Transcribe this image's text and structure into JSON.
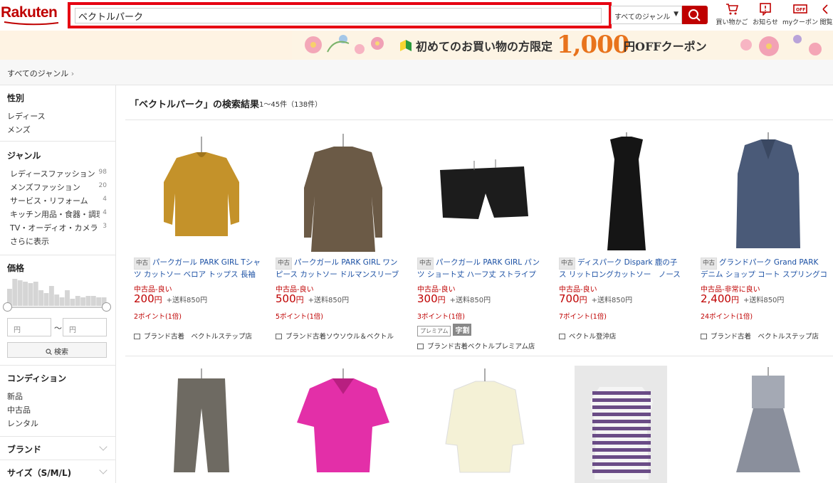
{
  "header": {
    "logo": "Rakuten",
    "search_value": "ベクトルパーク",
    "genre_select": "すべてのジャンル",
    "icons": [
      {
        "label": "買い物かご",
        "icon": "cart-icon"
      },
      {
        "label": "お知らせ",
        "icon": "notice-icon"
      },
      {
        "label": "myクーポン",
        "icon": "coupon-icon"
      },
      {
        "label": "閲覧",
        "icon": "history-icon"
      }
    ]
  },
  "banner": {
    "text": "初めてのお買い物の方限定",
    "amount": "1,000",
    "suffix": "円OFFクーポン"
  },
  "breadcrumb": {
    "root": "すべてのジャンル",
    "sep": "›"
  },
  "sidebar": {
    "gender": {
      "title": "性別",
      "items": [
        "レディース",
        "メンズ"
      ]
    },
    "genre": {
      "title": "ジャンル",
      "items": [
        {
          "label": "レディースファッション",
          "count": "98"
        },
        {
          "label": "メンズファッション",
          "count": "20"
        },
        {
          "label": "サービス・リフォーム",
          "count": "4"
        },
        {
          "label": "キッチン用品・食器・調理器",
          "count": "4"
        },
        {
          "label": "TV・オーディオ・カメラ",
          "count": "3"
        }
      ],
      "more": "さらに表示"
    },
    "price": {
      "title": "価格",
      "min_placeholder": "円",
      "max_placeholder": "円",
      "sep": "～",
      "search": "検索",
      "histogram": [
        0.6,
        0.95,
        0.9,
        0.85,
        0.8,
        0.85,
        0.55,
        0.45,
        0.7,
        0.4,
        0.3,
        0.55,
        0.25,
        0.35,
        0.3,
        0.35,
        0.35,
        0.3,
        0.3
      ]
    },
    "condition": {
      "title": "コンディション",
      "items": [
        "新品",
        "中古品",
        "レンタル"
      ]
    },
    "brand": {
      "title": "ブランド"
    },
    "size": {
      "title": "サイズ（S/M/L)"
    }
  },
  "results": {
    "title": "「ベクトルパーク」の検索結果",
    "count": "1～45件（138件）",
    "items": [
      {
        "tag": "中古",
        "title": "パークガール PARK GIRL Tシャツ カットソー ベロア トップス 長袖 黄",
        "condition": "中古品-良い",
        "price": "200",
        "yen": "円",
        "shipping": "+送料850円",
        "points": "2ポイント(1倍)",
        "shop": "ブランド古着　ベクトルステップ店",
        "color": "#c4922a"
      },
      {
        "tag": "中古",
        "title": "パークガール PARK GIRL ワンピース カットソー ドルマンスリーブ ワ",
        "condition": "中古品-良い",
        "price": "500",
        "yen": "円",
        "shipping": "+送料850円",
        "points": "5ポイント(1倍)",
        "shop": "ブランド古着ソウソウル＆ベクトル",
        "color": "#6b5a46"
      },
      {
        "tag": "中古",
        "title": "パークガール PARK GIRL パンツ ショート丈 ハーフ丈 ストライプ 黒 M",
        "condition": "中古品-良い",
        "price": "300",
        "yen": "円",
        "shipping": "+送料850円",
        "points": "3ポイント(1倍)",
        "badge1": "プレミアム",
        "badge2": "字割",
        "shop": "ブランド古着ベクトルプレミアム店",
        "color": "#1c1c1c"
      },
      {
        "tag": "中古",
        "title": "ディスパーク Dispark 鹿の子　ス リットロングカットソー　ノースリーブ",
        "condition": "中古品-良い",
        "price": "700",
        "yen": "円",
        "shipping": "+送料850円",
        "points": "7ポイント(1倍)",
        "shop": "ベクトル登沖店",
        "color": "#151515"
      },
      {
        "tag": "中古",
        "title": "グランドパーク Grand PARK デニム ショップ コート スプリングコート",
        "condition": "中古品-非常に良い",
        "price": "2,400",
        "yen": "円",
        "shipping": "+送料850円",
        "points": "24ポイント(1倍)",
        "shop": "ブランド古着　ベクトルステップ店",
        "color": "#4a5a78"
      }
    ],
    "row2": [
      {
        "color": "#6e6a62",
        "kind": "pants"
      },
      {
        "color": "#e32fa8",
        "kind": "top"
      },
      {
        "color": "#f4f1d6",
        "kind": "knit"
      },
      {
        "color": "#6a4c86",
        "kind": "stripe"
      },
      {
        "color": "#8a8f9c",
        "kind": "dress"
      }
    ]
  }
}
